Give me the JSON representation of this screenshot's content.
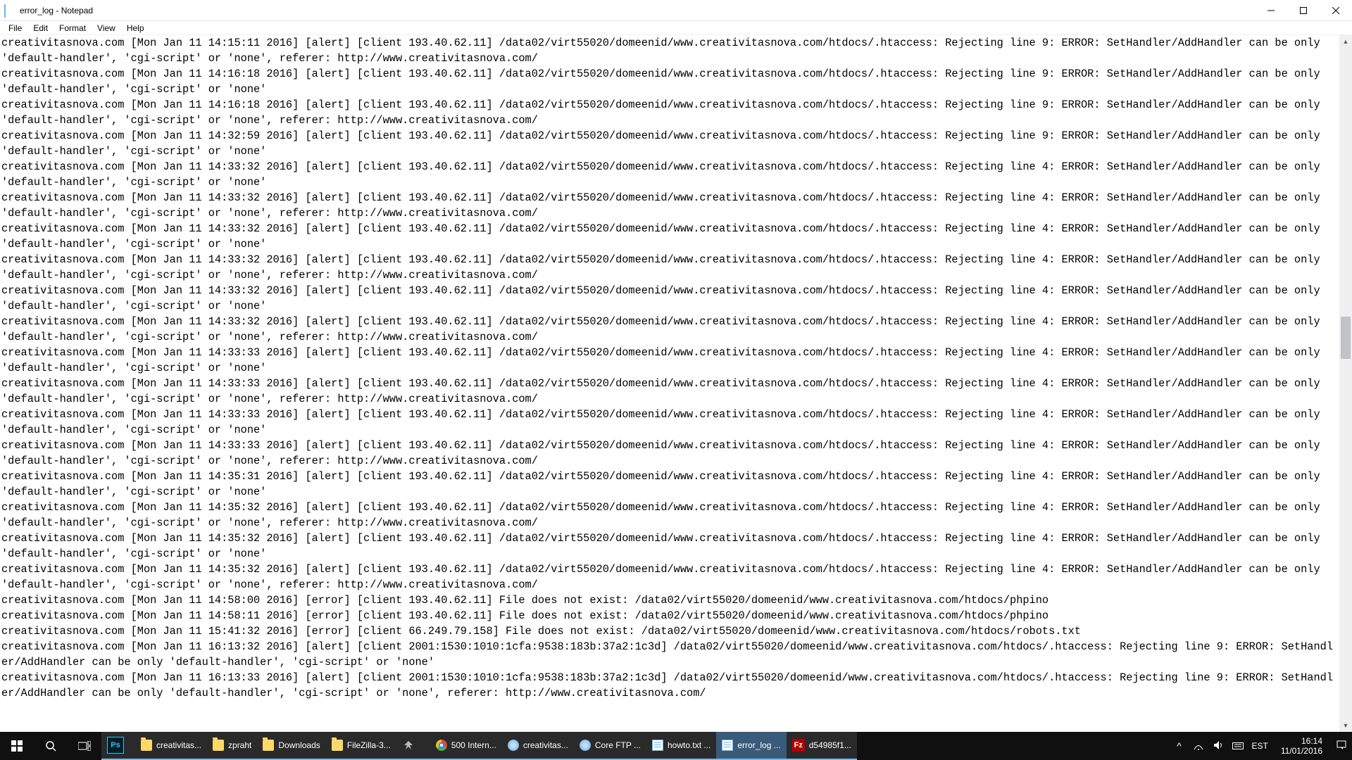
{
  "window": {
    "title": "error_log - Notepad"
  },
  "menu": {
    "items": [
      "File",
      "Edit",
      "Format",
      "View",
      "Help"
    ]
  },
  "log": {
    "entries": [
      {
        "ts": "Mon Jan 11 14:15:11 2016",
        "lvl": "alert",
        "client": "193.40.62.11",
        "line": 9,
        "referer": "http://www.creativitasnova.com/"
      },
      {
        "ts": "Mon Jan 11 14:16:18 2016",
        "lvl": "alert",
        "client": "193.40.62.11",
        "line": 9,
        "referer": ""
      },
      {
        "ts": "Mon Jan 11 14:16:18 2016",
        "lvl": "alert",
        "client": "193.40.62.11",
        "line": 9,
        "referer": "http://www.creativitasnova.com/"
      },
      {
        "ts": "Mon Jan 11 14:32:59 2016",
        "lvl": "alert",
        "client": "193.40.62.11",
        "line": 9,
        "referer": ""
      },
      {
        "ts": "Mon Jan 11 14:33:32 2016",
        "lvl": "alert",
        "client": "193.40.62.11",
        "line": 4,
        "referer": ""
      },
      {
        "ts": "Mon Jan 11 14:33:32 2016",
        "lvl": "alert",
        "client": "193.40.62.11",
        "line": 4,
        "referer": "http://www.creativitasnova.com/"
      },
      {
        "ts": "Mon Jan 11 14:33:32 2016",
        "lvl": "alert",
        "client": "193.40.62.11",
        "line": 4,
        "referer": ""
      },
      {
        "ts": "Mon Jan 11 14:33:32 2016",
        "lvl": "alert",
        "client": "193.40.62.11",
        "line": 4,
        "referer": "http://www.creativitasnova.com/"
      },
      {
        "ts": "Mon Jan 11 14:33:32 2016",
        "lvl": "alert",
        "client": "193.40.62.11",
        "line": 4,
        "referer": ""
      },
      {
        "ts": "Mon Jan 11 14:33:32 2016",
        "lvl": "alert",
        "client": "193.40.62.11",
        "line": 4,
        "referer": "http://www.creativitasnova.com/"
      },
      {
        "ts": "Mon Jan 11 14:33:33 2016",
        "lvl": "alert",
        "client": "193.40.62.11",
        "line": 4,
        "referer": ""
      },
      {
        "ts": "Mon Jan 11 14:33:33 2016",
        "lvl": "alert",
        "client": "193.40.62.11",
        "line": 4,
        "referer": "http://www.creativitasnova.com/"
      },
      {
        "ts": "Mon Jan 11 14:33:33 2016",
        "lvl": "alert",
        "client": "193.40.62.11",
        "line": 4,
        "referer": ""
      },
      {
        "ts": "Mon Jan 11 14:33:33 2016",
        "lvl": "alert",
        "client": "193.40.62.11",
        "line": 4,
        "referer": "http://www.creativitasnova.com/"
      },
      {
        "ts": "Mon Jan 11 14:35:31 2016",
        "lvl": "alert",
        "client": "193.40.62.11",
        "line": 4,
        "referer": ""
      },
      {
        "ts": "Mon Jan 11 14:35:32 2016",
        "lvl": "alert",
        "client": "193.40.62.11",
        "line": 4,
        "referer": "http://www.creativitasnova.com/"
      },
      {
        "ts": "Mon Jan 11 14:35:32 2016",
        "lvl": "alert",
        "client": "193.40.62.11",
        "line": 4,
        "referer": ""
      },
      {
        "ts": "Mon Jan 11 14:35:32 2016",
        "lvl": "alert",
        "client": "193.40.62.11",
        "line": 4,
        "referer": "http://www.creativitasnova.com/"
      }
    ],
    "error_entries": [
      {
        "ts": "Mon Jan 11 14:58:00 2016",
        "client": "193.40.62.11",
        "path": "/data02/virt55020/domeenid/www.creativitasnova.com/htdocs/phpino"
      },
      {
        "ts": "Mon Jan 11 14:58:11 2016",
        "client": "193.40.62.11",
        "path": "/data02/virt55020/domeenid/www.creativitasnova.com/htdocs/phpino"
      },
      {
        "ts": "Mon Jan 11 15:41:32 2016",
        "client": "66.249.79.158",
        "path": "/data02/virt55020/domeenid/www.creativitasnova.com/htdocs/robots.txt"
      }
    ],
    "ipv6_entries": [
      {
        "ts": "Mon Jan 11 16:13:32 2016",
        "client": "2001:1530:1010:1cfa:9538:183b:37a2:1c3d",
        "line": 9,
        "referer": ""
      },
      {
        "ts": "Mon Jan 11 16:13:33 2016",
        "client": "2001:1530:1010:1cfa:9538:183b:37a2:1c3d",
        "line": 9,
        "referer": "http://www.creativitasnova.com/"
      }
    ],
    "domain": "creativitasnova.com",
    "htaccess_path": "/data02/virt55020/domeenid/www.creativitasnova.com/htdocs/.htaccess",
    "msg_prefix": "SetHandler/AddHandler can be only 'default-handler', 'cgi-script' or 'none'",
    "rejecting": "Rejecting line",
    "error_word": "ERROR:",
    "fne": "File does not exist:"
  },
  "taskbar": {
    "items": [
      {
        "label": "creativitas..."
      },
      {
        "label": "zpraht"
      },
      {
        "label": "Downloads"
      },
      {
        "label": "FileZilla-3..."
      },
      {
        "label": ""
      },
      {
        "label": "500 Intern..."
      },
      {
        "label": "creativitas..."
      },
      {
        "label": "Core FTP ..."
      },
      {
        "label": "howto.txt ..."
      },
      {
        "label": "error_log ..."
      },
      {
        "label": "d54985f1..."
      }
    ],
    "lang": "EST",
    "time": "16:14",
    "date": "11/01/2016"
  }
}
